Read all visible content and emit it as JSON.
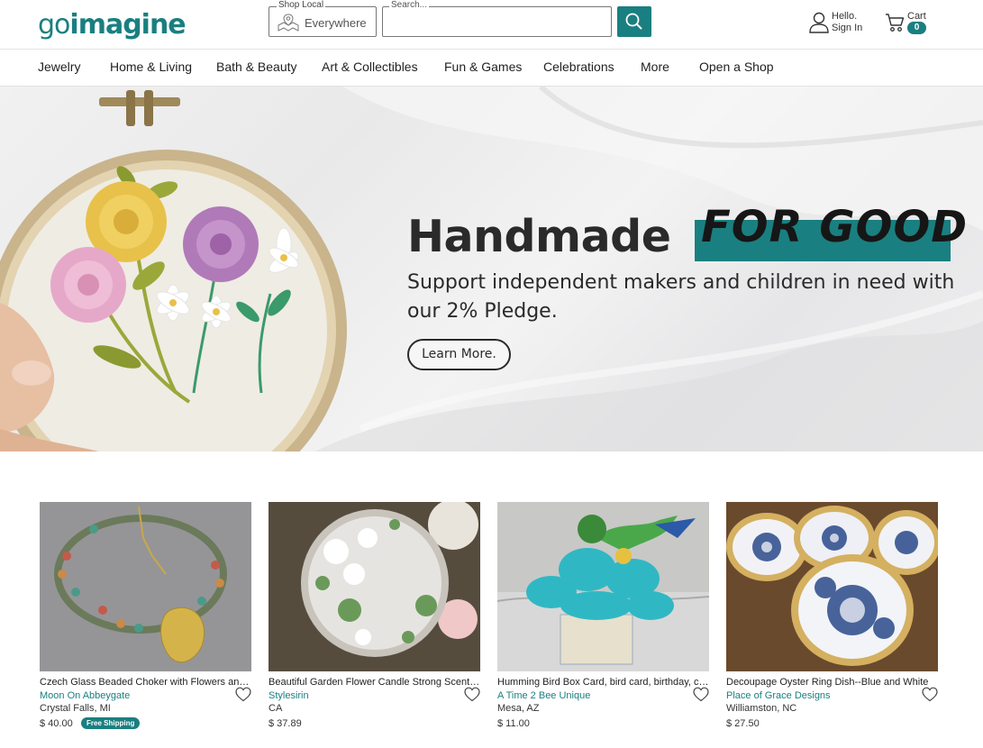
{
  "header": {
    "logo_go": "go",
    "logo_imagine": "imagine",
    "shop_local_label": "Shop Local",
    "shop_local_value": "Everywhere",
    "search_label": "Search...",
    "search_value": "",
    "account_line1": "Hello.",
    "account_line2": "Sign In",
    "cart_label": "Cart",
    "cart_count": "0"
  },
  "nav": {
    "items": [
      "Jewelry",
      "Home & Living",
      "Bath & Beauty",
      "Art & Collectibles",
      "Fun & Games",
      "Celebrations",
      "More",
      "Open a Shop"
    ]
  },
  "hero": {
    "title": "Handmade",
    "title_accent": "FOR GOOD",
    "subtitle": "Support independent makers and children in need with our 2% Pledge.",
    "button": "Learn More."
  },
  "products": [
    {
      "title": "Czech Glass Beaded Choker with Flowers and Leaf Pendant",
      "shop": "Moon On Abbeygate",
      "location": "Crystal Falls, MI",
      "price": "$ 40.00",
      "badge": "Free Shipping"
    },
    {
      "title": "Beautiful Garden Flower Candle Strong Scented",
      "shop": "Stylesirin",
      "location": "CA",
      "price": "$ 37.89",
      "badge": ""
    },
    {
      "title": "Humming Bird Box Card, bird card, birthday, card",
      "shop": "A Time 2 Bee Unique",
      "location": "Mesa, AZ",
      "price": "$ 11.00",
      "badge": ""
    },
    {
      "title": "Decoupage Oyster Ring Dish--Blue and White",
      "shop": "Place of Grace Designs",
      "location": "Williamston, NC",
      "price": "$ 27.50",
      "badge": ""
    }
  ],
  "colors": {
    "brand": "#1a7f80",
    "text": "#222222"
  }
}
